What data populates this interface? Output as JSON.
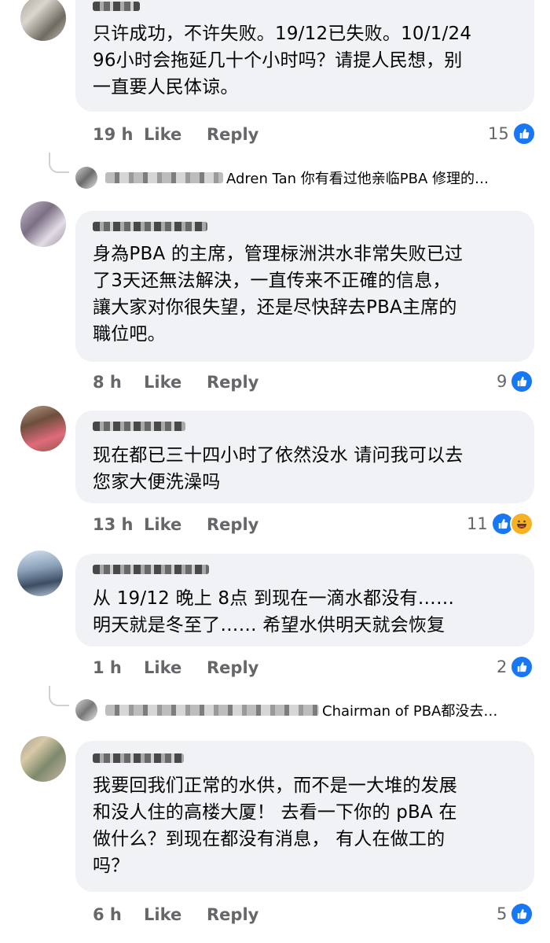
{
  "comments": [
    {
      "text": "只许成功，不许失败。19/12已失败。10/1/24\n96小时会拖延几十个小时吗？请提人民想，别\n一直要人民体谅。",
      "time": "19 h",
      "like": "Like",
      "reply": "Reply",
      "reactions": "15"
    },
    {
      "text": "身為PBA 的主席，管理柡洲洪水非常失败已过\n了3天还無法解決，一直传来不正確的信息，\n讓大家对你很失望，还是尽快辞去PBA主席的\n職位吧。",
      "time": "8 h",
      "like": "Like",
      "reply": "Reply",
      "reactions": "9"
    },
    {
      "text": "现在都已三十四小时了依然没水 请问我可以去\n您家大便洗澡吗",
      "time": "13 h",
      "like": "Like",
      "reply": "Reply",
      "reactions": "11"
    },
    {
      "text": "从 19/12 晚上 8点 到现在一滴水都没有……\n明天就是冬至了…… 希望水供明天就会恢复",
      "time": "1 h",
      "like": "Like",
      "reply": "Reply",
      "reactions": "2"
    },
    {
      "text": "我要回我们正常的水供，而不是一大堆的发展\n和没人住的高楼大厦！ 去看一下你的 pBA 在\n做什么？到现在都没有消息， 有人在做工的\n吗？",
      "time": "6 h",
      "like": "Like",
      "reply": "Reply",
      "reactions": "5"
    }
  ],
  "replies": [
    {
      "text": "Adren Tan 你有看过他亲临PBA 修理的…"
    },
    {
      "text": "Chairman of PBA都没去…"
    }
  ],
  "colors": {
    "bubble": "#f0f2f5",
    "meta": "#65676b",
    "like_blue": "#1877f2"
  }
}
